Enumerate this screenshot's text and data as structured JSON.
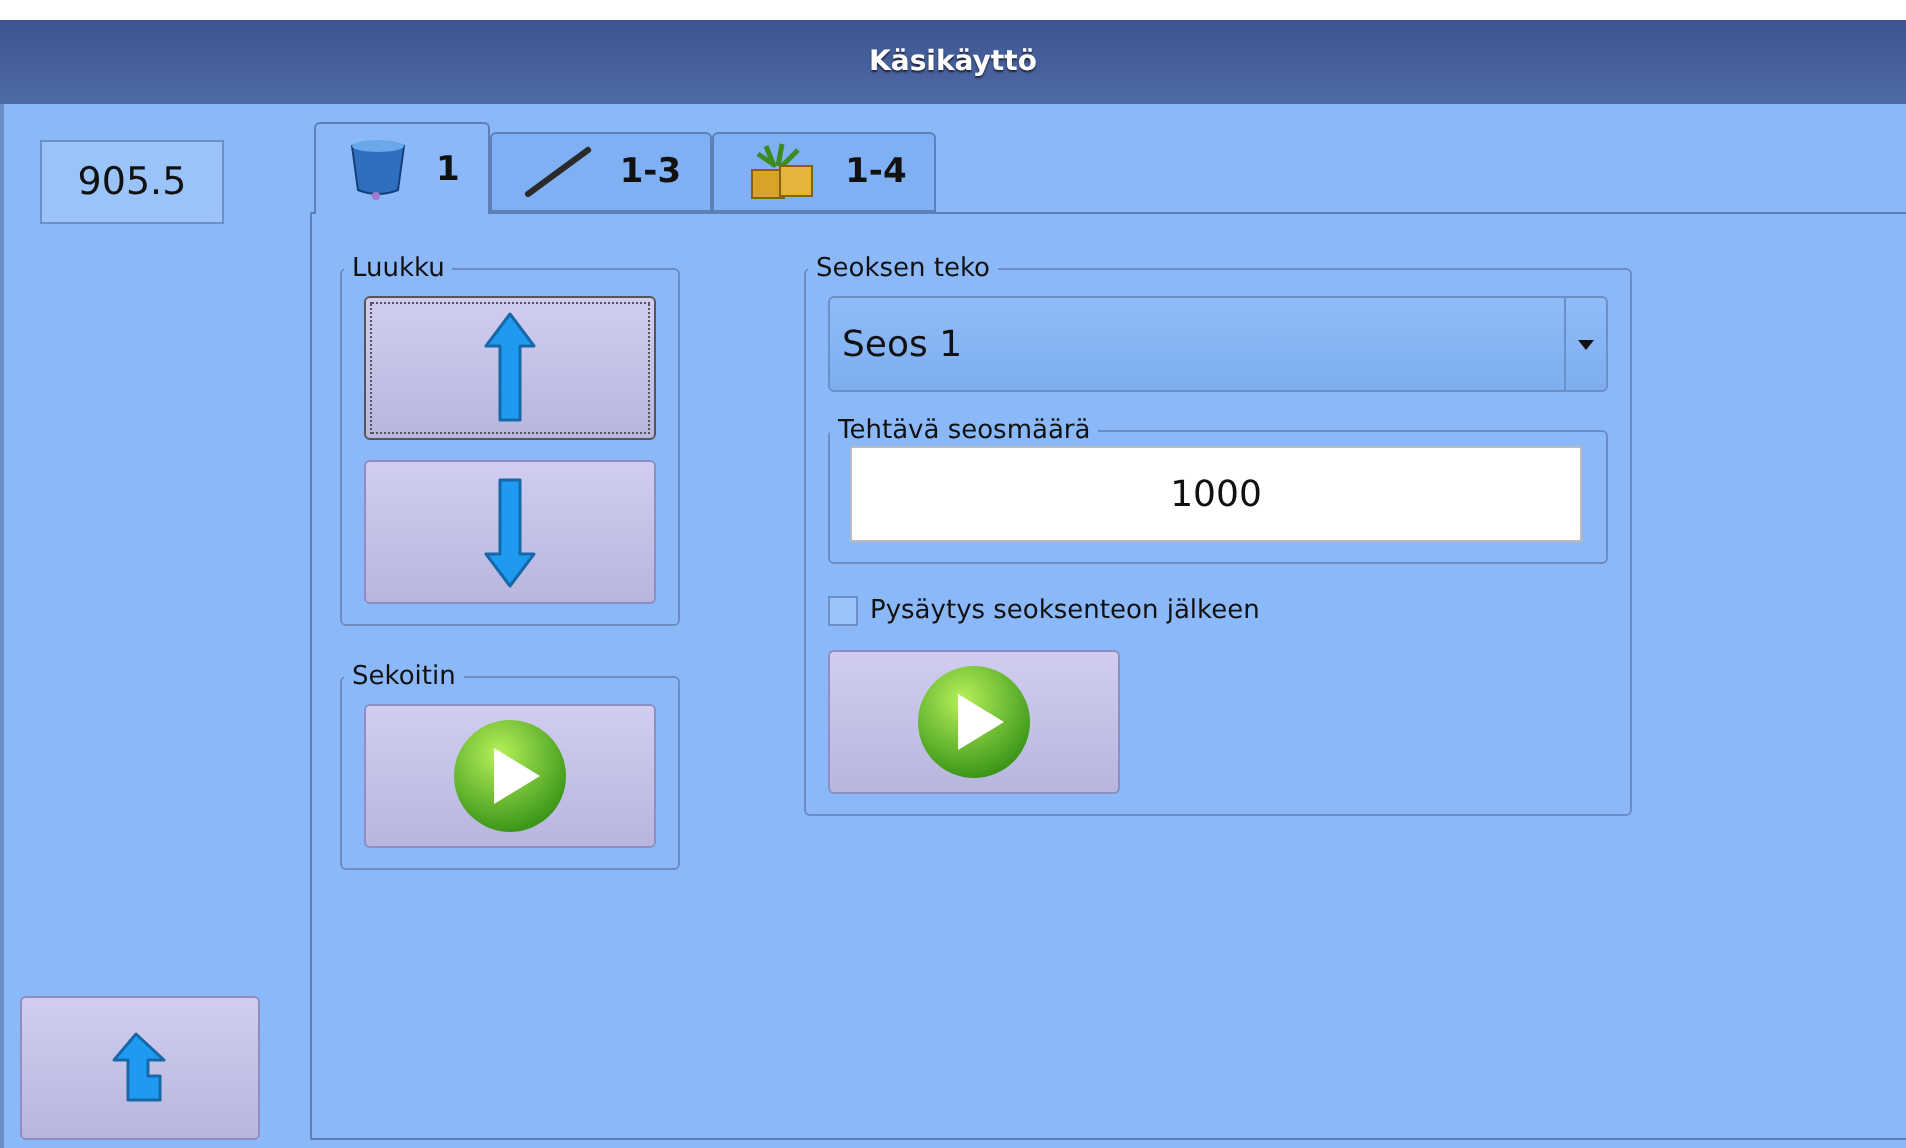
{
  "window": {
    "title": "Käsikäyttö"
  },
  "reading": "905.5",
  "tabs": [
    {
      "label": "1",
      "kind": "bucket",
      "selected": true
    },
    {
      "label": "1-3",
      "kind": "stick",
      "selected": false
    },
    {
      "label": "1-4",
      "kind": "bales",
      "selected": false
    }
  ],
  "hatch": {
    "title": "Luukku",
    "buttons": [
      {
        "kind": "up",
        "focused": true
      },
      {
        "kind": "down",
        "focused": false
      }
    ]
  },
  "mixer": {
    "title": "Sekoitin"
  },
  "mix": {
    "title": "Seoksen teko",
    "selection": "Seos 1",
    "amount_title": "Tehtävä seosmäärä",
    "amount": "1000",
    "stop_after": {
      "label": "Pysäytys seoksenteon jälkeen",
      "checked": false
    }
  }
}
